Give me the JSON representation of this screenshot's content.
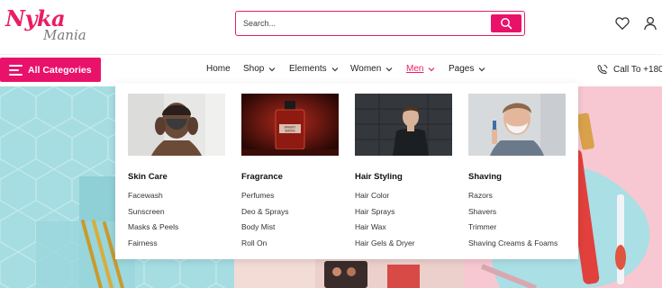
{
  "logo": {
    "line1": "Nyka",
    "line2": "Mania"
  },
  "search": {
    "placeholder": "Search..."
  },
  "header_icons": [
    "heart-icon",
    "user-icon",
    "search-icon"
  ],
  "navbar": {
    "all_categories": "All Categories",
    "items": [
      {
        "label": "Home",
        "dropdown": false
      },
      {
        "label": "Shop",
        "dropdown": true
      },
      {
        "label": "Elements",
        "dropdown": true
      },
      {
        "label": "Women",
        "dropdown": true
      },
      {
        "label": "Men",
        "dropdown": true
      },
      {
        "label": "Pages",
        "dropdown": true
      }
    ],
    "call_label": "Call To +180"
  },
  "mega_menu": {
    "columns": [
      {
        "title": "Skin Care",
        "image": "man-with-face-mask",
        "links": [
          "Facewash",
          "Sunscreen",
          "Masks & Peels",
          "Fairness"
        ]
      },
      {
        "title": "Fragrance",
        "image": "whisky-smoke-perfume-bottle",
        "image_text": "WHISKY SMOKE",
        "links": [
          "Perfumes",
          "Deo & Sprays",
          "Body Mist",
          "Roll On"
        ]
      },
      {
        "title": "Hair Styling",
        "image": "man-portrait-dark-wall",
        "links": [
          "Hair Color",
          "Hair Sprays",
          "Hair Wax",
          "Hair Gels & Dryer"
        ]
      },
      {
        "title": "Shaving",
        "image": "man-shaving-foam",
        "links": [
          "Razors",
          "Shavers",
          "Trimmer",
          "Shaving Creams & Foams"
        ]
      }
    ]
  },
  "colors": {
    "accent": "#e8126b",
    "active_nav": "#e91e63",
    "banner_left": "#a6dde2",
    "banner_right": "#f7c8d2"
  }
}
